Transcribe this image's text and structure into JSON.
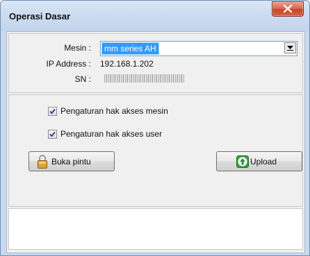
{
  "window": {
    "title": "Operasi Dasar",
    "close_label": "X"
  },
  "device": {
    "machine_label": "Mesin :",
    "machine_value": "mm series AH",
    "ip_label": "IP Address :",
    "ip_value": "192.168.1.202",
    "sn_label": "SN :"
  },
  "options": [
    {
      "label": "Pengaturan hak akses mesin",
      "checked": true
    },
    {
      "label": "Pengaturan hak akses user",
      "checked": true
    }
  ],
  "actions": {
    "open_door_label": "Buka pintu",
    "upload_label": "Upload"
  },
  "icons": {
    "close": "close-icon",
    "dropdown": "chevron-down-icon",
    "check": "check-icon",
    "lock": "lock-icon",
    "upload": "upload-icon"
  },
  "colors": {
    "selection": "#3399ff",
    "titlebar": "#cddcf0",
    "close_button": "#c8452a",
    "upload_icon": "#3aa33a"
  }
}
